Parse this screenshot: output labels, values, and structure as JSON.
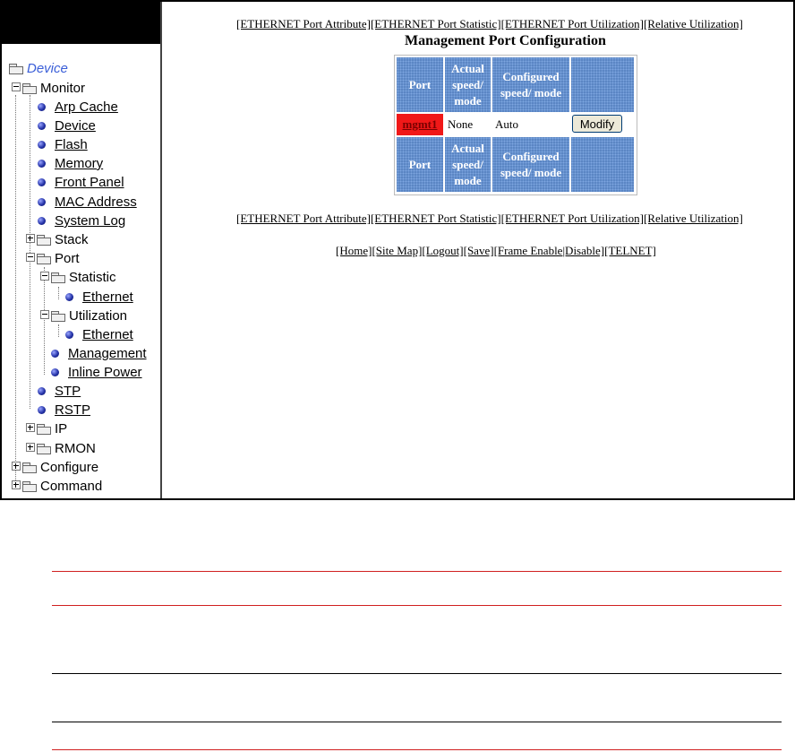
{
  "tree": {
    "root": "Device",
    "monitor": "Monitor",
    "monitor_items": [
      "Arp Cache",
      "Device",
      "Flash",
      "Memory",
      "Front Panel",
      "MAC Address",
      "System Log"
    ],
    "stack": "Stack",
    "port": "Port",
    "statistic": "Statistic",
    "statistic_ethernet": "Ethernet",
    "utilization": "Utilization",
    "utilization_ethernet": "Ethernet",
    "management": "Management",
    "inline_power": "Inline Power",
    "stp": "STP",
    "rstp": "RSTP",
    "ip": "IP",
    "rmon": "RMON",
    "configure": "Configure",
    "command": "Command"
  },
  "top_links": [
    "[ETHERNET Port Attribute]",
    "[ETHERNET Port Statistic]",
    "[ETHERNET Port Utilization]",
    "[Relative Utilization]"
  ],
  "page_title": "Management Port Configuration",
  "table": {
    "headers": [
      "Port",
      "Actual speed/ mode",
      "Configured speed/ mode",
      ""
    ],
    "row": {
      "port": "mgmt1",
      "actual": "None",
      "configured": "Auto",
      "action": "Modify"
    }
  },
  "bottom_links": [
    "[Home]",
    "[Site Map]",
    "[Logout]",
    "[Save]",
    "[Frame Enable",
    "|Disable]",
    "[TELNET]"
  ],
  "colors": {
    "header_blue": "#5b86c4",
    "port_red": "#f01818",
    "root_blue": "#3a5ed8",
    "rule_red": "#d02020"
  }
}
